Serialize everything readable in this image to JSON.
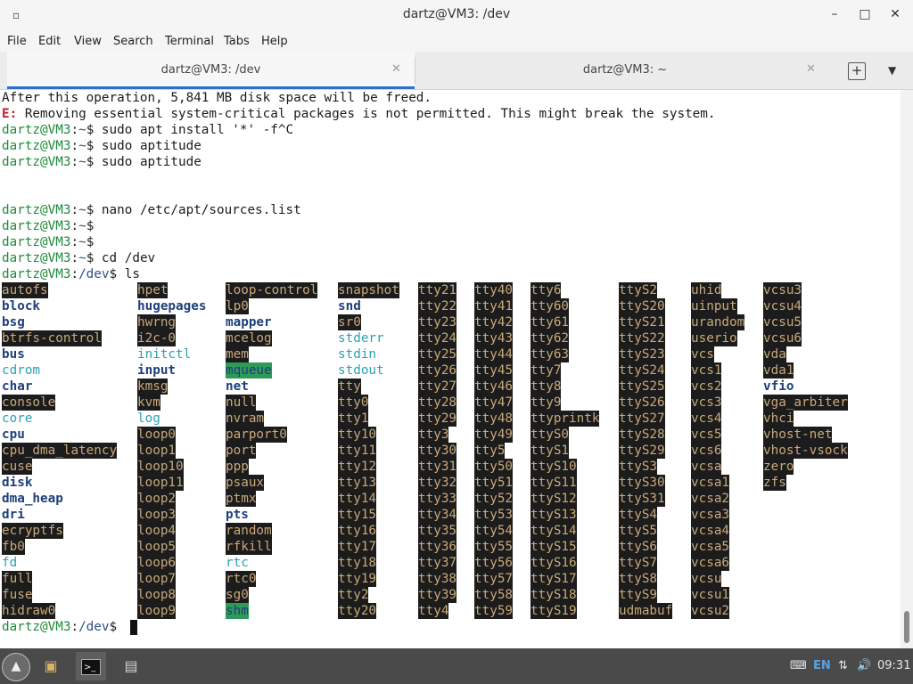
{
  "window": {
    "title": "dartz@VM3: /dev",
    "app_icon": "▫",
    "minimize": "–",
    "maximize": "□",
    "close": "✕"
  },
  "menu": [
    "File",
    "Edit",
    "View",
    "Search",
    "Terminal",
    "Tabs",
    "Help"
  ],
  "tabs": [
    {
      "label": "dartz@VM3: /dev",
      "active": true,
      "close": "✕"
    },
    {
      "label": "dartz@VM3: ~",
      "active": false,
      "close": "✕"
    }
  ],
  "tab_actions": {
    "new_tab": "+",
    "menu": "▼"
  },
  "terminal": {
    "lines": [
      {
        "type": "text",
        "text": "After this operation, 5,841 MB disk space will be freed."
      },
      {
        "type": "error",
        "prefix": "E:",
        "text": " Removing essential system-critical packages is not permitted. This might break the system."
      },
      {
        "type": "cmd",
        "user": "dartz@VM3",
        "path": "~",
        "cmd": " sudo apt install '*' -f^C"
      },
      {
        "type": "cmd",
        "user": "dartz@VM3",
        "path": "~",
        "cmd": " sudo aptitude"
      },
      {
        "type": "cmd",
        "user": "dartz@VM3",
        "path": "~",
        "cmd": " sudo aptitude"
      },
      {
        "type": "blank",
        "text": ""
      },
      {
        "type": "blank",
        "text": ""
      },
      {
        "type": "cmd",
        "user": "dartz@VM3",
        "path": "~",
        "cmd": " nano /etc/apt/sources.list"
      },
      {
        "type": "cmd",
        "user": "dartz@VM3",
        "path": "~",
        "cmd": ""
      },
      {
        "type": "cmd",
        "user": "dartz@VM3",
        "path": "~",
        "cmd": ""
      },
      {
        "type": "cmd",
        "user": "dartz@VM3",
        "path": "~",
        "cmd": " cd /dev"
      },
      {
        "type": "cmd",
        "user": "dartz@VM3",
        "path": "/dev",
        "cmd": " ls"
      }
    ],
    "ls_columns": [
      [
        [
          "autofs",
          "h"
        ],
        [
          "block",
          "d"
        ],
        [
          "bsg",
          "d"
        ],
        [
          "btrfs-control",
          "h"
        ],
        [
          "bus",
          "d"
        ],
        [
          "cdrom",
          "l"
        ],
        [
          "char",
          "d"
        ],
        [
          "console",
          "h"
        ],
        [
          "core",
          "l"
        ],
        [
          "cpu",
          "d"
        ],
        [
          "cpu_dma_latency",
          "h"
        ],
        [
          "cuse",
          "h"
        ],
        [
          "disk",
          "d"
        ],
        [
          "dma_heap",
          "d"
        ],
        [
          "dri",
          "d"
        ],
        [
          "ecryptfs",
          "h"
        ],
        [
          "fb0",
          "h"
        ],
        [
          "fd",
          "l"
        ],
        [
          "full",
          "h"
        ],
        [
          "fuse",
          "h"
        ],
        [
          "hidraw0",
          "h"
        ]
      ],
      [
        [
          "hpet",
          "h"
        ],
        [
          "hugepages",
          "d"
        ],
        [
          "hwrng",
          "h"
        ],
        [
          "i2c-0",
          "h"
        ],
        [
          "initctl",
          "l"
        ],
        [
          "input",
          "d"
        ],
        [
          "kmsg",
          "h"
        ],
        [
          "kvm",
          "h"
        ],
        [
          "log",
          "l"
        ],
        [
          "loop0",
          "h"
        ],
        [
          "loop1",
          "h"
        ],
        [
          "loop10",
          "h"
        ],
        [
          "loop11",
          "h"
        ],
        [
          "loop2",
          "h"
        ],
        [
          "loop3",
          "h"
        ],
        [
          "loop4",
          "h"
        ],
        [
          "loop5",
          "h"
        ],
        [
          "loop6",
          "h"
        ],
        [
          "loop7",
          "h"
        ],
        [
          "loop8",
          "h"
        ],
        [
          "loop9",
          "h"
        ]
      ],
      [
        [
          "loop-control",
          "h"
        ],
        [
          "lp0",
          "h"
        ],
        [
          "mapper",
          "d"
        ],
        [
          "mcelog",
          "h"
        ],
        [
          "mem",
          "h"
        ],
        [
          "mqueue",
          "s"
        ],
        [
          "net",
          "d"
        ],
        [
          "null",
          "h"
        ],
        [
          "nvram",
          "h"
        ],
        [
          "parport0",
          "h"
        ],
        [
          "port",
          "h"
        ],
        [
          "ppp",
          "h"
        ],
        [
          "psaux",
          "h"
        ],
        [
          "ptmx",
          "h"
        ],
        [
          "pts",
          "d"
        ],
        [
          "random",
          "h"
        ],
        [
          "rfkill",
          "h"
        ],
        [
          "rtc",
          "l"
        ],
        [
          "rtc0",
          "h"
        ],
        [
          "sg0",
          "h"
        ],
        [
          "shm",
          "s"
        ]
      ],
      [
        [
          "snapshot",
          "h"
        ],
        [
          "snd",
          "d"
        ],
        [
          "sr0",
          "h"
        ],
        [
          "stderr",
          "l"
        ],
        [
          "stdin",
          "l"
        ],
        [
          "stdout",
          "l"
        ],
        [
          "tty",
          "h"
        ],
        [
          "tty0",
          "h"
        ],
        [
          "tty1",
          "h"
        ],
        [
          "tty10",
          "h"
        ],
        [
          "tty11",
          "h"
        ],
        [
          "tty12",
          "h"
        ],
        [
          "tty13",
          "h"
        ],
        [
          "tty14",
          "h"
        ],
        [
          "tty15",
          "h"
        ],
        [
          "tty16",
          "h"
        ],
        [
          "tty17",
          "h"
        ],
        [
          "tty18",
          "h"
        ],
        [
          "tty19",
          "h"
        ],
        [
          "tty2",
          "h"
        ],
        [
          "tty20",
          "h"
        ]
      ],
      [
        [
          "tty21",
          "h"
        ],
        [
          "tty22",
          "h"
        ],
        [
          "tty23",
          "h"
        ],
        [
          "tty24",
          "h"
        ],
        [
          "tty25",
          "h"
        ],
        [
          "tty26",
          "h"
        ],
        [
          "tty27",
          "h"
        ],
        [
          "tty28",
          "h"
        ],
        [
          "tty29",
          "h"
        ],
        [
          "tty3",
          "h"
        ],
        [
          "tty30",
          "h"
        ],
        [
          "tty31",
          "h"
        ],
        [
          "tty32",
          "h"
        ],
        [
          "tty33",
          "h"
        ],
        [
          "tty34",
          "h"
        ],
        [
          "tty35",
          "h"
        ],
        [
          "tty36",
          "h"
        ],
        [
          "tty37",
          "h"
        ],
        [
          "tty38",
          "h"
        ],
        [
          "tty39",
          "h"
        ],
        [
          "tty4",
          "h"
        ]
      ],
      [
        [
          "tty40",
          "h"
        ],
        [
          "tty41",
          "h"
        ],
        [
          "tty42",
          "h"
        ],
        [
          "tty43",
          "h"
        ],
        [
          "tty44",
          "h"
        ],
        [
          "tty45",
          "h"
        ],
        [
          "tty46",
          "h"
        ],
        [
          "tty47",
          "h"
        ],
        [
          "tty48",
          "h"
        ],
        [
          "tty49",
          "h"
        ],
        [
          "tty5",
          "h"
        ],
        [
          "tty50",
          "h"
        ],
        [
          "tty51",
          "h"
        ],
        [
          "tty52",
          "h"
        ],
        [
          "tty53",
          "h"
        ],
        [
          "tty54",
          "h"
        ],
        [
          "tty55",
          "h"
        ],
        [
          "tty56",
          "h"
        ],
        [
          "tty57",
          "h"
        ],
        [
          "tty58",
          "h"
        ],
        [
          "tty59",
          "h"
        ]
      ],
      [
        [
          "tty6",
          "h"
        ],
        [
          "tty60",
          "h"
        ],
        [
          "tty61",
          "h"
        ],
        [
          "tty62",
          "h"
        ],
        [
          "tty63",
          "h"
        ],
        [
          "tty7",
          "h"
        ],
        [
          "tty8",
          "h"
        ],
        [
          "tty9",
          "h"
        ],
        [
          "ttyprintk",
          "h"
        ],
        [
          "ttyS0",
          "h"
        ],
        [
          "ttyS1",
          "h"
        ],
        [
          "ttyS10",
          "h"
        ],
        [
          "ttyS11",
          "h"
        ],
        [
          "ttyS12",
          "h"
        ],
        [
          "ttyS13",
          "h"
        ],
        [
          "ttyS14",
          "h"
        ],
        [
          "ttyS15",
          "h"
        ],
        [
          "ttyS16",
          "h"
        ],
        [
          "ttyS17",
          "h"
        ],
        [
          "ttyS18",
          "h"
        ],
        [
          "ttyS19",
          "h"
        ]
      ],
      [
        [
          "ttyS2",
          "h"
        ],
        [
          "ttyS20",
          "h"
        ],
        [
          "ttyS21",
          "h"
        ],
        [
          "ttyS22",
          "h"
        ],
        [
          "ttyS23",
          "h"
        ],
        [
          "ttyS24",
          "h"
        ],
        [
          "ttyS25",
          "h"
        ],
        [
          "ttyS26",
          "h"
        ],
        [
          "ttyS27",
          "h"
        ],
        [
          "ttyS28",
          "h"
        ],
        [
          "ttyS29",
          "h"
        ],
        [
          "ttyS3",
          "h"
        ],
        [
          "ttyS30",
          "h"
        ],
        [
          "ttyS31",
          "h"
        ],
        [
          "ttyS4",
          "h"
        ],
        [
          "ttyS5",
          "h"
        ],
        [
          "ttyS6",
          "h"
        ],
        [
          "ttyS7",
          "h"
        ],
        [
          "ttyS8",
          "h"
        ],
        [
          "ttyS9",
          "h"
        ],
        [
          "udmabuf",
          "h"
        ]
      ],
      [
        [
          "uhid",
          "h"
        ],
        [
          "uinput",
          "h"
        ],
        [
          "urandom",
          "h"
        ],
        [
          "userio",
          "h"
        ],
        [
          "vcs",
          "h"
        ],
        [
          "vcs1",
          "h"
        ],
        [
          "vcs2",
          "h"
        ],
        [
          "vcs3",
          "h"
        ],
        [
          "vcs4",
          "h"
        ],
        [
          "vcs5",
          "h"
        ],
        [
          "vcs6",
          "h"
        ],
        [
          "vcsa",
          "h"
        ],
        [
          "vcsa1",
          "h"
        ],
        [
          "vcsa2",
          "h"
        ],
        [
          "vcsa3",
          "h"
        ],
        [
          "vcsa4",
          "h"
        ],
        [
          "vcsa5",
          "h"
        ],
        [
          "vcsa6",
          "h"
        ],
        [
          "vcsu",
          "h"
        ],
        [
          "vcsu1",
          "h"
        ],
        [
          "vcsu2",
          "h"
        ]
      ],
      [
        [
          "vcsu3",
          "h"
        ],
        [
          "vcsu4",
          "h"
        ],
        [
          "vcsu5",
          "h"
        ],
        [
          "vcsu6",
          "h"
        ],
        [
          "vda",
          "h"
        ],
        [
          "vda1",
          "h"
        ],
        [
          "vfio",
          "d"
        ],
        [
          "vga_arbiter",
          "h"
        ],
        [
          "vhci",
          "h"
        ],
        [
          "vhost-net",
          "h"
        ],
        [
          "vhost-vsock",
          "h"
        ],
        [
          "zero",
          "h"
        ],
        [
          "zfs",
          "h"
        ]
      ]
    ],
    "final_prompt": {
      "user": "dartz@VM3",
      "path": "/dev"
    }
  },
  "taskbar": {
    "launcher_icon": "mountain-logo",
    "apps": [
      {
        "name": "file-manager-icon",
        "glyph": "▣"
      },
      {
        "name": "terminal-icon",
        "glyph": ">_"
      },
      {
        "name": "file-cabinet-icon",
        "glyph": "▤"
      }
    ],
    "tray": {
      "keyboard_icon": "⌨",
      "lang": "EN",
      "network_icon": "⇅",
      "volume_icon": "🔊",
      "time": "09:31"
    }
  }
}
